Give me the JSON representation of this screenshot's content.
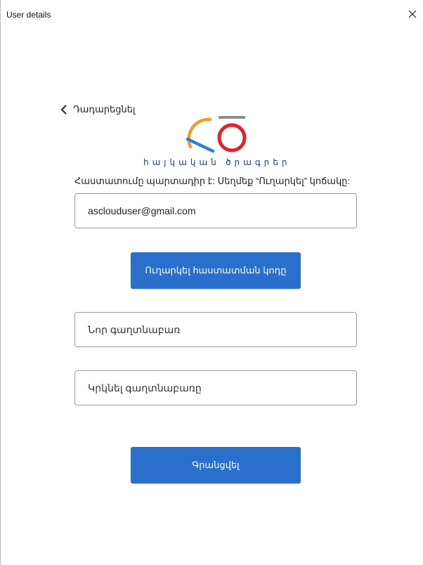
{
  "window": {
    "title": "User details"
  },
  "back": {
    "label": "Դադարեցնել"
  },
  "logo": {
    "tagline": "հայկական ծրագրեր"
  },
  "form": {
    "hint": "Հաստատումը պարտադիր է: Սեղմեք “Ուղարկել” կոճակը:",
    "email_value": "asclouduser@gmail.com",
    "send_code_label": "Ուղարկել հաստատման կոդը",
    "new_password_placeholder": "Նոր գաղտնաբառ",
    "repeat_password_placeholder": "Կրկնել գաղտնաբառը",
    "register_label": "Գրանցվել"
  },
  "colors": {
    "primary": "#2a6fcb",
    "logo_orange": "#f29a2e",
    "logo_blue": "#2d7fd3",
    "logo_red": "#e2222a",
    "logo_gray": "#8c8c8c"
  }
}
